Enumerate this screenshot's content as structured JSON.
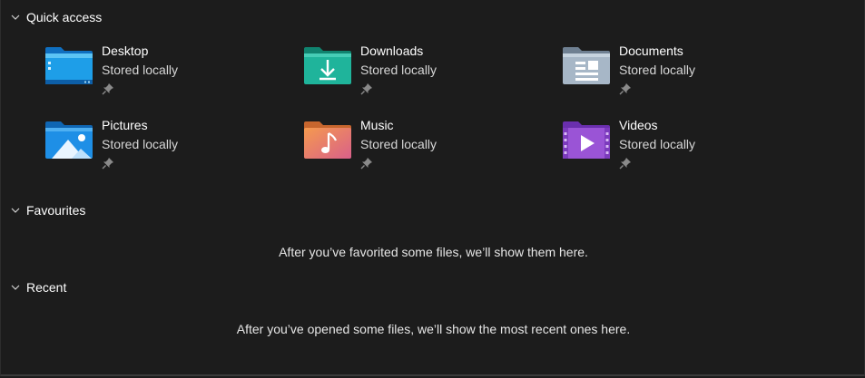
{
  "sections": {
    "quick_access": {
      "title": "Quick access",
      "items": [
        {
          "name": "Desktop",
          "status": "Stored locally",
          "icon": "desktop-folder-icon"
        },
        {
          "name": "Downloads",
          "status": "Stored locally",
          "icon": "downloads-folder-icon"
        },
        {
          "name": "Documents",
          "status": "Stored locally",
          "icon": "documents-folder-icon"
        },
        {
          "name": "Pictures",
          "status": "Stored locally",
          "icon": "pictures-folder-icon"
        },
        {
          "name": "Music",
          "status": "Stored locally",
          "icon": "music-folder-icon"
        },
        {
          "name": "Videos",
          "status": "Stored locally",
          "icon": "videos-folder-icon"
        }
      ]
    },
    "favourites": {
      "title": "Favourites",
      "empty_message": "After you’ve favorited some files, we’ll show them here."
    },
    "recent": {
      "title": "Recent",
      "empty_message": "After you’ve opened some files, we’ll show the most recent ones here."
    }
  },
  "colors": {
    "background": "#1c1c1c",
    "text": "#ffffff",
    "desktop_folder": "#1e9ee8",
    "downloads_folder": "#1fb49b",
    "documents_folder": "#a7b7c7",
    "pictures_folder": "#1e8fe6",
    "music_folder": "#f0805a",
    "videos_folder": "#9a54d6"
  }
}
